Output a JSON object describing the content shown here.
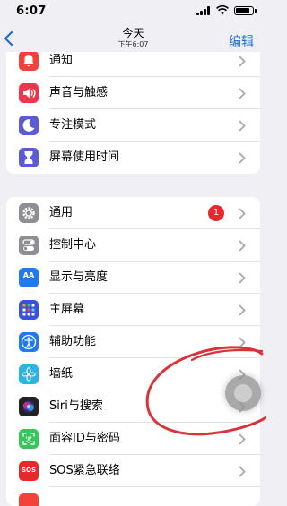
{
  "status_bar": {
    "time": "6:07"
  },
  "nav": {
    "title": "今天",
    "subtitle": "下午6:07",
    "edit_label": "编辑"
  },
  "group1": [
    {
      "label": "通知",
      "icon": "bell-icon",
      "color": "#f2423a"
    },
    {
      "label": "声音与触感",
      "icon": "speaker-icon",
      "color": "#f0344c"
    },
    {
      "label": "专注模式",
      "icon": "moon-icon",
      "color": "#5d5bd4"
    },
    {
      "label": "屏幕使用时间",
      "icon": "hourglass-icon",
      "color": "#5d5bd4"
    }
  ],
  "group2": [
    {
      "label": "通用",
      "icon": "gear-icon",
      "color": "#8e8e93",
      "badge": "1"
    },
    {
      "label": "控制中心",
      "icon": "toggles-icon",
      "color": "#8e8e93"
    },
    {
      "label": "显示与亮度",
      "icon": "text-size-icon",
      "color": "#1f7af2",
      "icon_text": "AA"
    },
    {
      "label": "主屏幕",
      "icon": "home-grid-icon",
      "color": "#3a52d6"
    },
    {
      "label": "辅助功能",
      "icon": "accessibility-icon",
      "color": "#1f7af2"
    },
    {
      "label": "墙纸",
      "icon": "flower-icon",
      "color": "#2fb3e0"
    },
    {
      "label": "Siri与搜索",
      "icon": "siri-icon",
      "color": "#222222"
    },
    {
      "label": "面容ID与密码",
      "icon": "face-id-icon",
      "color": "#34c759"
    },
    {
      "label": "SOS紧急联络",
      "icon": "sos-icon",
      "color": "#e8292c",
      "icon_text": "SOS"
    }
  ]
}
